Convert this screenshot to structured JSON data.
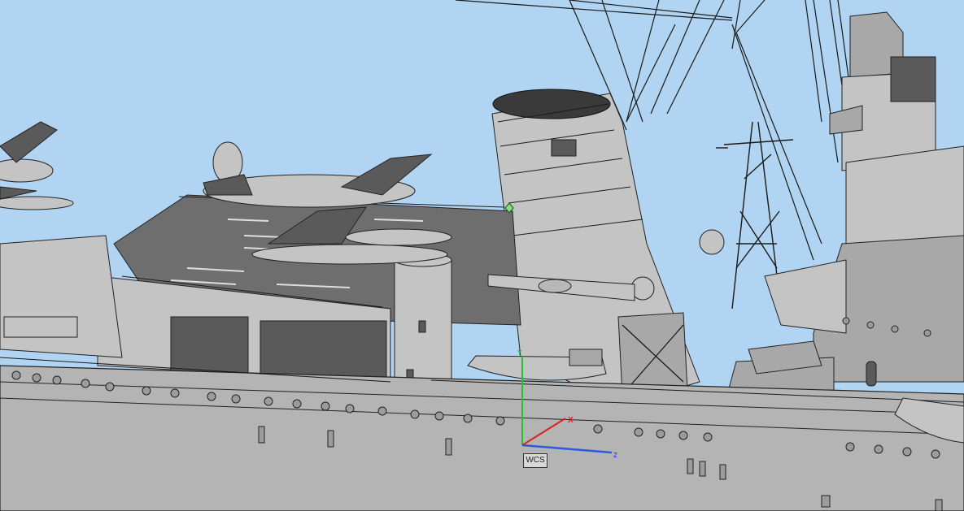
{
  "viewport": {
    "background": "#b0d4f2",
    "model": "cruiser"
  },
  "wcs": {
    "label": "WCS",
    "x_label": "X",
    "y_label": "Y",
    "z_label": "Z",
    "x_color": "#e02020",
    "y_color": "#22c22a",
    "z_color": "#2a5ae0"
  },
  "icons": {
    "pivot": "pivot-point-icon"
  }
}
